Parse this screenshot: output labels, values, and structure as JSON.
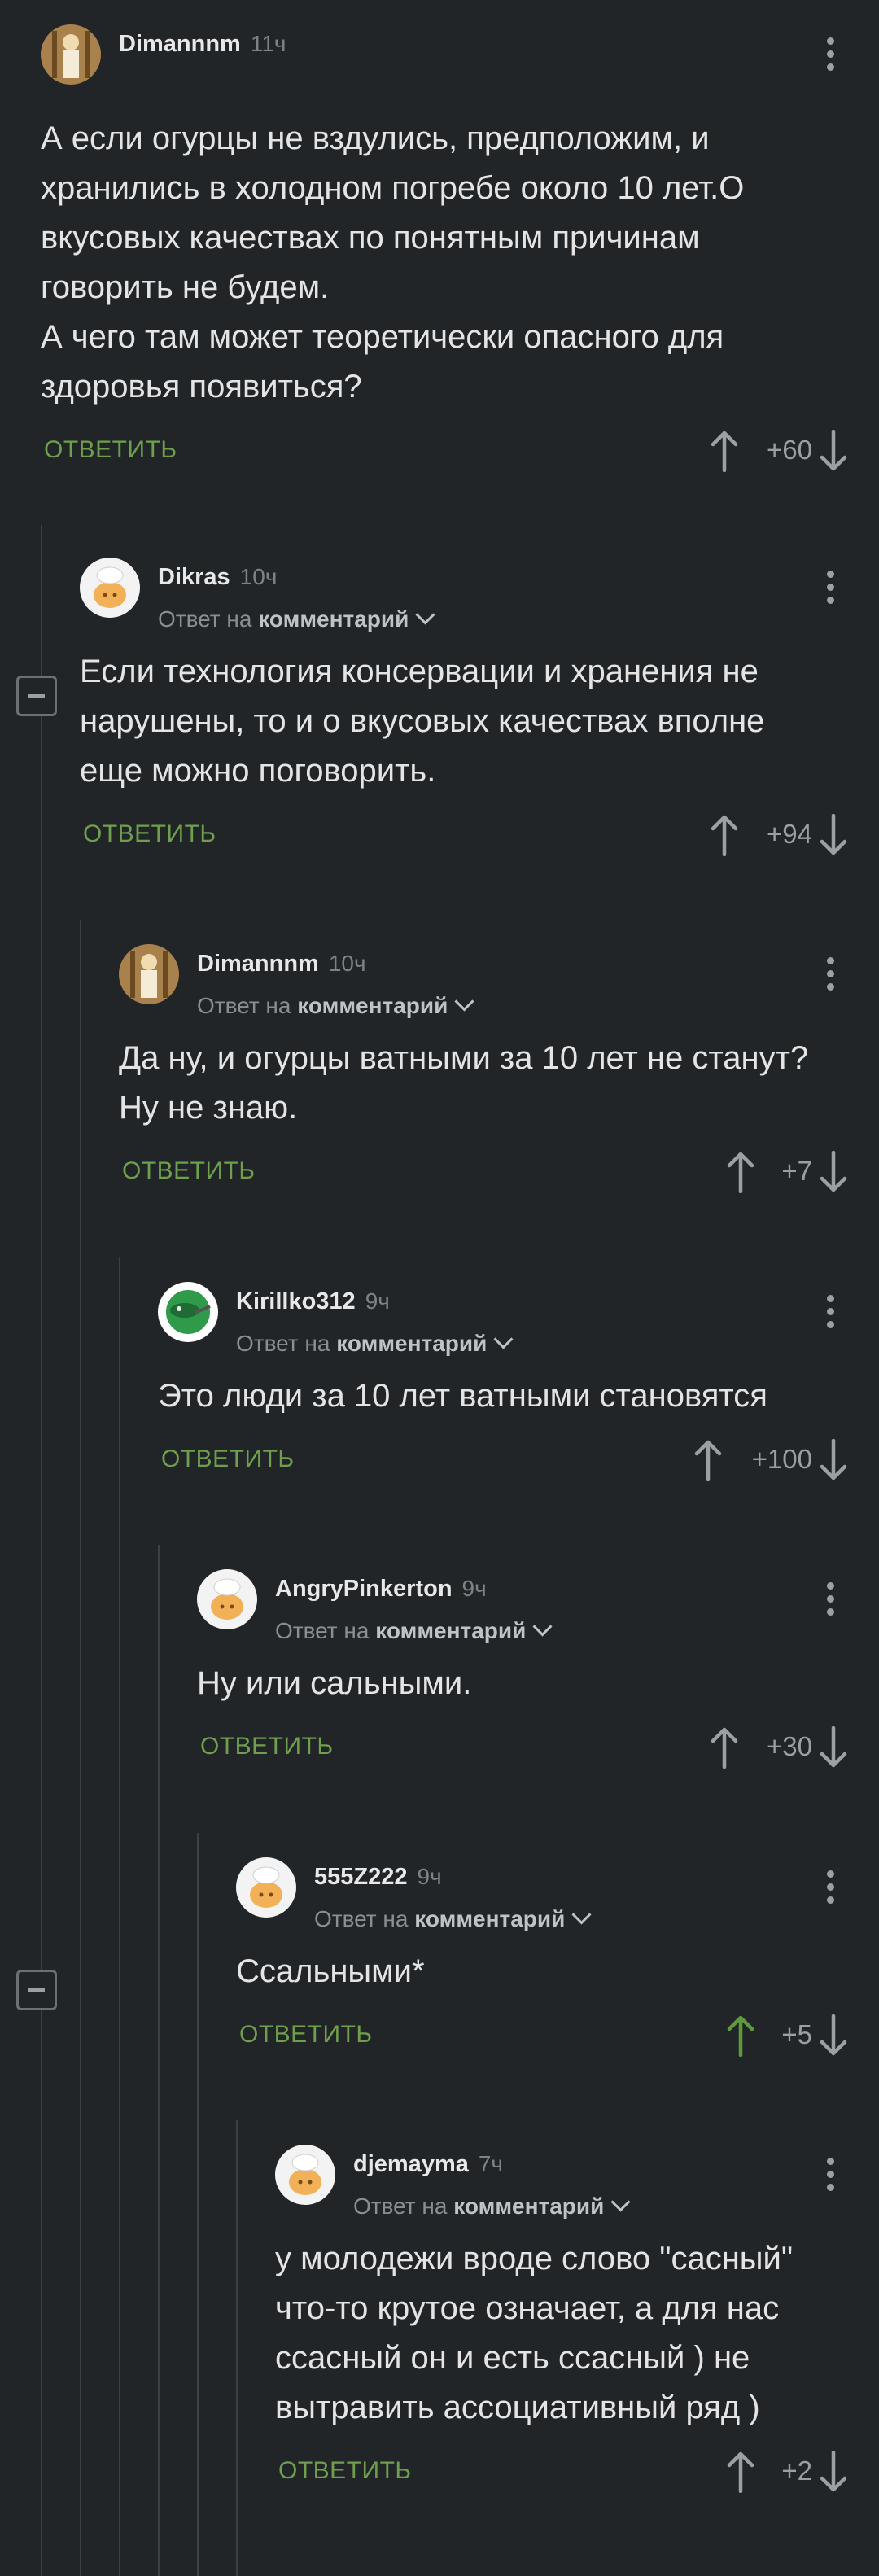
{
  "comments": [
    {
      "id": "c1",
      "user": "Dimannnm",
      "time": "11ч",
      "reply_to_prefix": "",
      "reply_to_target": "",
      "text": [
        "А если огурцы не вздулись, предположим, и",
        "хранились в холодном погребе около 10 лет.О",
        "вкусовых качествах по понятным причинам",
        "говорить не будем.",
        "А чего там может теоретически опасного для",
        "здоровья появиться?"
      ],
      "reply_label": "ОТВЕТИТЬ",
      "score": "+60",
      "avatar": "person-avatar",
      "upvoted": false
    },
    {
      "id": "c2",
      "user": "Dikras",
      "time": "10ч",
      "reply_to_prefix": "Ответ на",
      "reply_to_target": "комментарий",
      "text": [
        "Если технология консервации и хранения не",
        "нарушены, то и о вкусовых качествах вполне",
        "еще можно поговорить."
      ],
      "reply_label": "ОТВЕТИТЬ",
      "score": "+94",
      "avatar": "chef-avatar",
      "upvoted": false
    },
    {
      "id": "c3",
      "user": "Dimannnm",
      "time": "10ч",
      "reply_to_prefix": "Ответ на",
      "reply_to_target": "комментарий",
      "text": [
        "Да ну, и огурцы ватными за 10 лет не станут?",
        "Ну не знаю."
      ],
      "reply_label": "ОТВЕТИТЬ",
      "score": "+7",
      "avatar": "person-avatar",
      "upvoted": false
    },
    {
      "id": "c4",
      "user": "Kirillko312",
      "time": "9ч",
      "reply_to_prefix": "Ответ на",
      "reply_to_target": "комментарий",
      "text": [
        "Это люди за 10 лет ватными становятся"
      ],
      "reply_label": "ОТВЕТИТЬ",
      "score": "+100",
      "avatar": "green-avatar",
      "upvoted": false
    },
    {
      "id": "c5",
      "user": "AngryPinkerton",
      "time": "9ч",
      "reply_to_prefix": "Ответ на",
      "reply_to_target": "комментарий",
      "text": [
        "Ну или сальными."
      ],
      "reply_label": "ОТВЕТИТЬ",
      "score": "+30",
      "avatar": "chef-avatar",
      "upvoted": false
    },
    {
      "id": "c6",
      "user": "555Z222",
      "time": "9ч",
      "reply_to_prefix": "Ответ на",
      "reply_to_target": "комментарий",
      "text": [
        "Ссальными*"
      ],
      "reply_label": "ОТВЕТИТЬ",
      "score": "+5",
      "avatar": "chef-avatar",
      "upvoted": true
    },
    {
      "id": "c7",
      "user": "djemayma",
      "time": "7ч",
      "reply_to_prefix": "Ответ на",
      "reply_to_target": "комментарий",
      "text": [
        "у молодежи вроде слово \"сасный\"",
        "что-то крутое означает, а для нас",
        "ссасный он и есть ссасный ) не",
        "вытравить ассоциативный ряд )"
      ],
      "reply_label": "ОТВЕТИТЬ",
      "score": "+2",
      "avatar": "chef-avatar",
      "upvoted": false
    }
  ],
  "colors": {
    "background": "#222527",
    "reply_green": "#6e9e4e",
    "upvote_active": "#5e9a3c",
    "thread_line": "#3c4043"
  }
}
